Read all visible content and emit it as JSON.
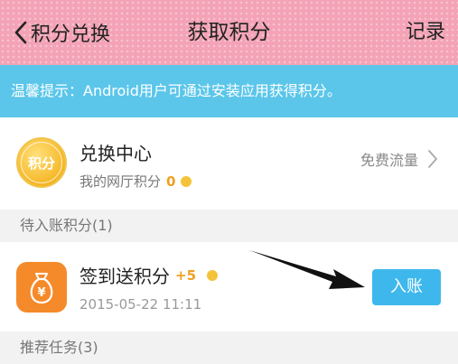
{
  "header": {
    "back_label": "积分兑换",
    "title": "获取积分",
    "record_label": "记录"
  },
  "notice": {
    "text": "温馨提示：Android用户可通过安装应用获得积分。"
  },
  "exchange_center": {
    "coin_text": "积分",
    "title": "兑换中心",
    "points_label": "我的网厅积分",
    "points_value": "0",
    "free_traffic_label": "免费流量"
  },
  "sections": {
    "pending_label": "待入账积分(1)",
    "recommended_label": "推荐任务(3)"
  },
  "pending_task": {
    "title": "签到送积分",
    "bonus": "+5",
    "date": "2015-05-22 11:11",
    "claim_label": "入账"
  },
  "colors": {
    "header_bg": "#f3a3b5",
    "notice_bg": "#5bc6ea",
    "claim_button": "#3eb8ec",
    "points_accent": "#f0a020",
    "task_icon_bg": "#f58a2a"
  },
  "icons": {
    "back": "chevron-left-icon",
    "coin": "points-coin-icon",
    "forward": "chevron-right-icon",
    "task": "money-bag-icon",
    "bullet": "coin-dot-icon"
  }
}
